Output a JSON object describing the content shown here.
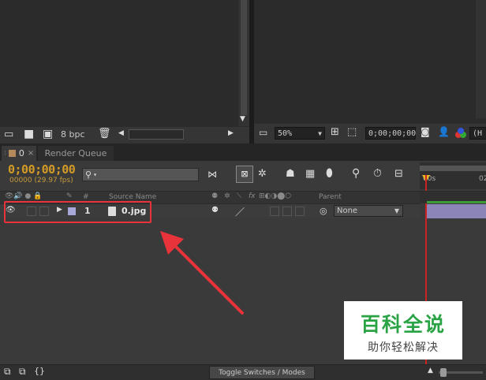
{
  "project_panel": {
    "bpc_label": "8 bpc"
  },
  "viewer": {
    "zoom": "50%",
    "timecode": "0;00;00;00",
    "channel_label": "(H"
  },
  "tabs": [
    {
      "label": "0"
    },
    {
      "label": "Render Queue"
    }
  ],
  "timeline": {
    "current_time": "0;00;00;00",
    "frame_info": "00000 (29.97 fps)",
    "search_placeholder": "",
    "ruler_first": "00s",
    "ruler_second": "02",
    "column_number": "#",
    "column_source_name": "Source Name",
    "column_parent": "Parent",
    "column_switches": "fx",
    "layer": {
      "number": "1",
      "name": "0.jpg",
      "parent": "None",
      "label_color": "#a8a8d8",
      "bar_color": "#8c86b8"
    },
    "toggle_label": "Toggle Switches / Modes"
  },
  "watermark": {
    "title": "百科全说",
    "subtitle": "助你轻松解决",
    "title_color": "#2aa344"
  },
  "annotation": {
    "color": "#e8333a"
  }
}
